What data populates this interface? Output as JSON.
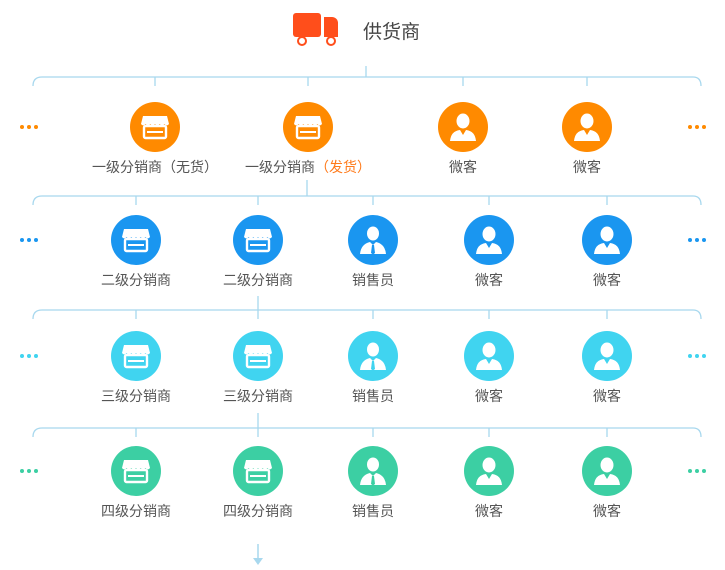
{
  "supplier": {
    "label": "供货商",
    "color": "#ff4e1b"
  },
  "line_color": "#a8d8ee",
  "rows": [
    {
      "color": "#ff8a00",
      "nodes": [
        {
          "icon": "store-icon",
          "text": "一级分销商（无货）"
        },
        {
          "icon": "store-icon",
          "text": "一级分销商",
          "highlight": "（发货）"
        },
        {
          "icon": "user-icon",
          "text": "微客"
        },
        {
          "icon": "user-icon",
          "text": "微客"
        }
      ]
    },
    {
      "color": "#1a96f0",
      "nodes": [
        {
          "icon": "store-icon",
          "text": "二级分销商"
        },
        {
          "icon": "store-icon",
          "text": "二级分销商"
        },
        {
          "icon": "salesperson-icon",
          "text": "销售员"
        },
        {
          "icon": "user-icon",
          "text": "微客"
        },
        {
          "icon": "user-icon",
          "text": "微客"
        }
      ]
    },
    {
      "color": "#40d4f0",
      "nodes": [
        {
          "icon": "store-icon",
          "text": "三级分销商"
        },
        {
          "icon": "store-icon",
          "text": "三级分销商"
        },
        {
          "icon": "salesperson-icon",
          "text": "销售员"
        },
        {
          "icon": "user-icon",
          "text": "微客"
        },
        {
          "icon": "user-icon",
          "text": "微客"
        }
      ]
    },
    {
      "color": "#3ccfa3",
      "nodes": [
        {
          "icon": "store-icon",
          "text": "四级分销商"
        },
        {
          "icon": "store-icon",
          "text": "四级分销商"
        },
        {
          "icon": "salesperson-icon",
          "text": "销售员"
        },
        {
          "icon": "user-icon",
          "text": "微客"
        },
        {
          "icon": "user-icon",
          "text": "微客"
        }
      ]
    }
  ]
}
